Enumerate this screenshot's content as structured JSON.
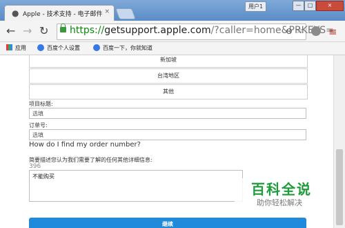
{
  "browser": {
    "tab": {
      "favicon": "apple-icon",
      "title": "Apple - 技术支持 - 电子邮件",
      "close": "×"
    },
    "user_label": "用户1",
    "window_controls": {
      "minimize": "—",
      "maximize": "□",
      "close": "×"
    },
    "nav": {
      "back": "←",
      "forward": "→",
      "reload": "↻"
    },
    "url": {
      "scheme": "https://",
      "host": "getsupport.apple.com",
      "path": "/?caller=home&PRKEYS="
    },
    "omnibox_icons": {
      "zoom": "⊖",
      "star": "☆"
    },
    "menu_icon": "≡",
    "bookmarks": [
      {
        "icon": "apps-icon",
        "label": "应用"
      },
      {
        "icon": "baidu-paw-icon",
        "label": "百度个人设置"
      },
      {
        "icon": "baidu-paw-icon",
        "label": "百度一下，你就知道"
      }
    ]
  },
  "form": {
    "regions": [
      "新加坡",
      "台湾地区",
      "其他"
    ],
    "subject": {
      "label": "项目标题:",
      "placeholder": "选填"
    },
    "order_number": {
      "label": "订单号:",
      "placeholder": "选填"
    },
    "find_order_link": "How do I find my order number?",
    "details": {
      "label": "简要描述您认为我们需要了解的任何其他详细信息:",
      "remaining": "396",
      "text": "不能购买"
    },
    "continue_label": "继续"
  },
  "watermark": {
    "title": "百科全说",
    "subtitle": "助你轻松解决"
  }
}
